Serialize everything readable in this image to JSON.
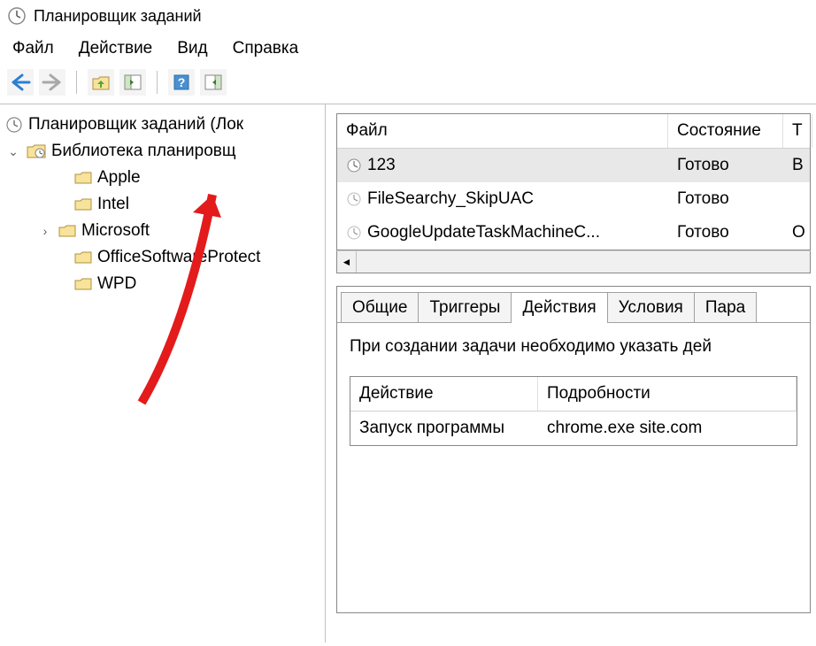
{
  "window": {
    "title": "Планировщик заданий"
  },
  "menu": {
    "file": "Файл",
    "action": "Действие",
    "view": "Вид",
    "help": "Справка"
  },
  "tree": {
    "root": "Планировщик заданий (Лок",
    "library": "Библиотека планировщ",
    "items": [
      {
        "label": "Apple",
        "expandable": false
      },
      {
        "label": "Intel",
        "expandable": false
      },
      {
        "label": "Microsoft",
        "expandable": true
      },
      {
        "label": "OfficeSoftwareProtect",
        "expandable": false
      },
      {
        "label": "WPD",
        "expandable": false
      }
    ]
  },
  "taskTable": {
    "headers": {
      "name": "Файл",
      "state": "Состояние",
      "trigger": "Т"
    },
    "rows": [
      {
        "name": "123",
        "state": "Готово",
        "trigger": "В",
        "selected": true
      },
      {
        "name": "FileSearchy_SkipUAC",
        "state": "Готово",
        "trigger": ""
      },
      {
        "name": "GoogleUpdateTaskMachineC...",
        "state": "Готово",
        "trigger": "О"
      }
    ]
  },
  "tabs": {
    "general": "Общие",
    "triggers": "Триггеры",
    "actions": "Действия",
    "conditions": "Условия",
    "params": "Пара",
    "active": "actions",
    "actionsBody": {
      "desc": "При создании задачи необходимо указать дей",
      "headers": {
        "action": "Действие",
        "details": "Подробности"
      },
      "row": {
        "action": "Запуск программы",
        "details": "chrome.exe site.com"
      }
    }
  }
}
